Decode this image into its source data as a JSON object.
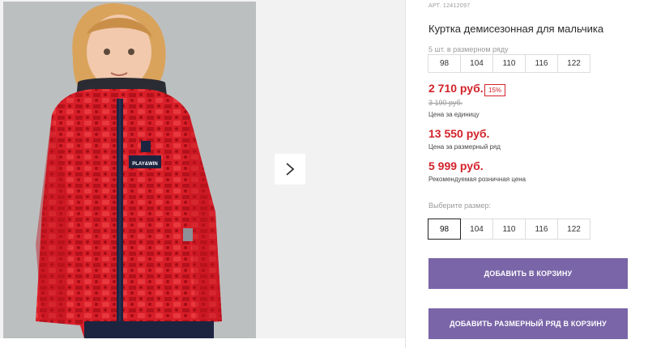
{
  "product": {
    "article": "АРТ. 12412097",
    "title": "Куртка демисезонная для мальчика",
    "patch_label": "PLAY&WIN"
  },
  "range": {
    "note": "5 шт. в размерном ряду",
    "sizes": [
      "98",
      "104",
      "110",
      "116",
      "122"
    ]
  },
  "prices": {
    "unit_price": "2 710 руб.",
    "discount_badge": "15%",
    "old_price": "3 190 руб.",
    "unit_note": "Цена за единицу",
    "range_price": "13 550 руб.",
    "range_note": "Цена за размерный ряд",
    "retail_price": "5 999 руб.",
    "retail_note": "Рекомендуемая розничная цена"
  },
  "size_select": {
    "label": "Выберите размер:",
    "sizes": [
      "98",
      "104",
      "110",
      "116",
      "122"
    ],
    "selected": "98"
  },
  "buttons": {
    "add_to_cart": "ДОБАВИТЬ В КОРЗИНУ",
    "add_range_to_cart": "ДОБАВИТЬ РАЗМЕРНЫЙ РЯД В КОРЗИНУ"
  },
  "colors": {
    "price_red": "#d3222a",
    "button_purple": "#7a65a8",
    "jacket_red": "#d81e28"
  },
  "icons": {
    "next": "chevron-right-icon"
  }
}
